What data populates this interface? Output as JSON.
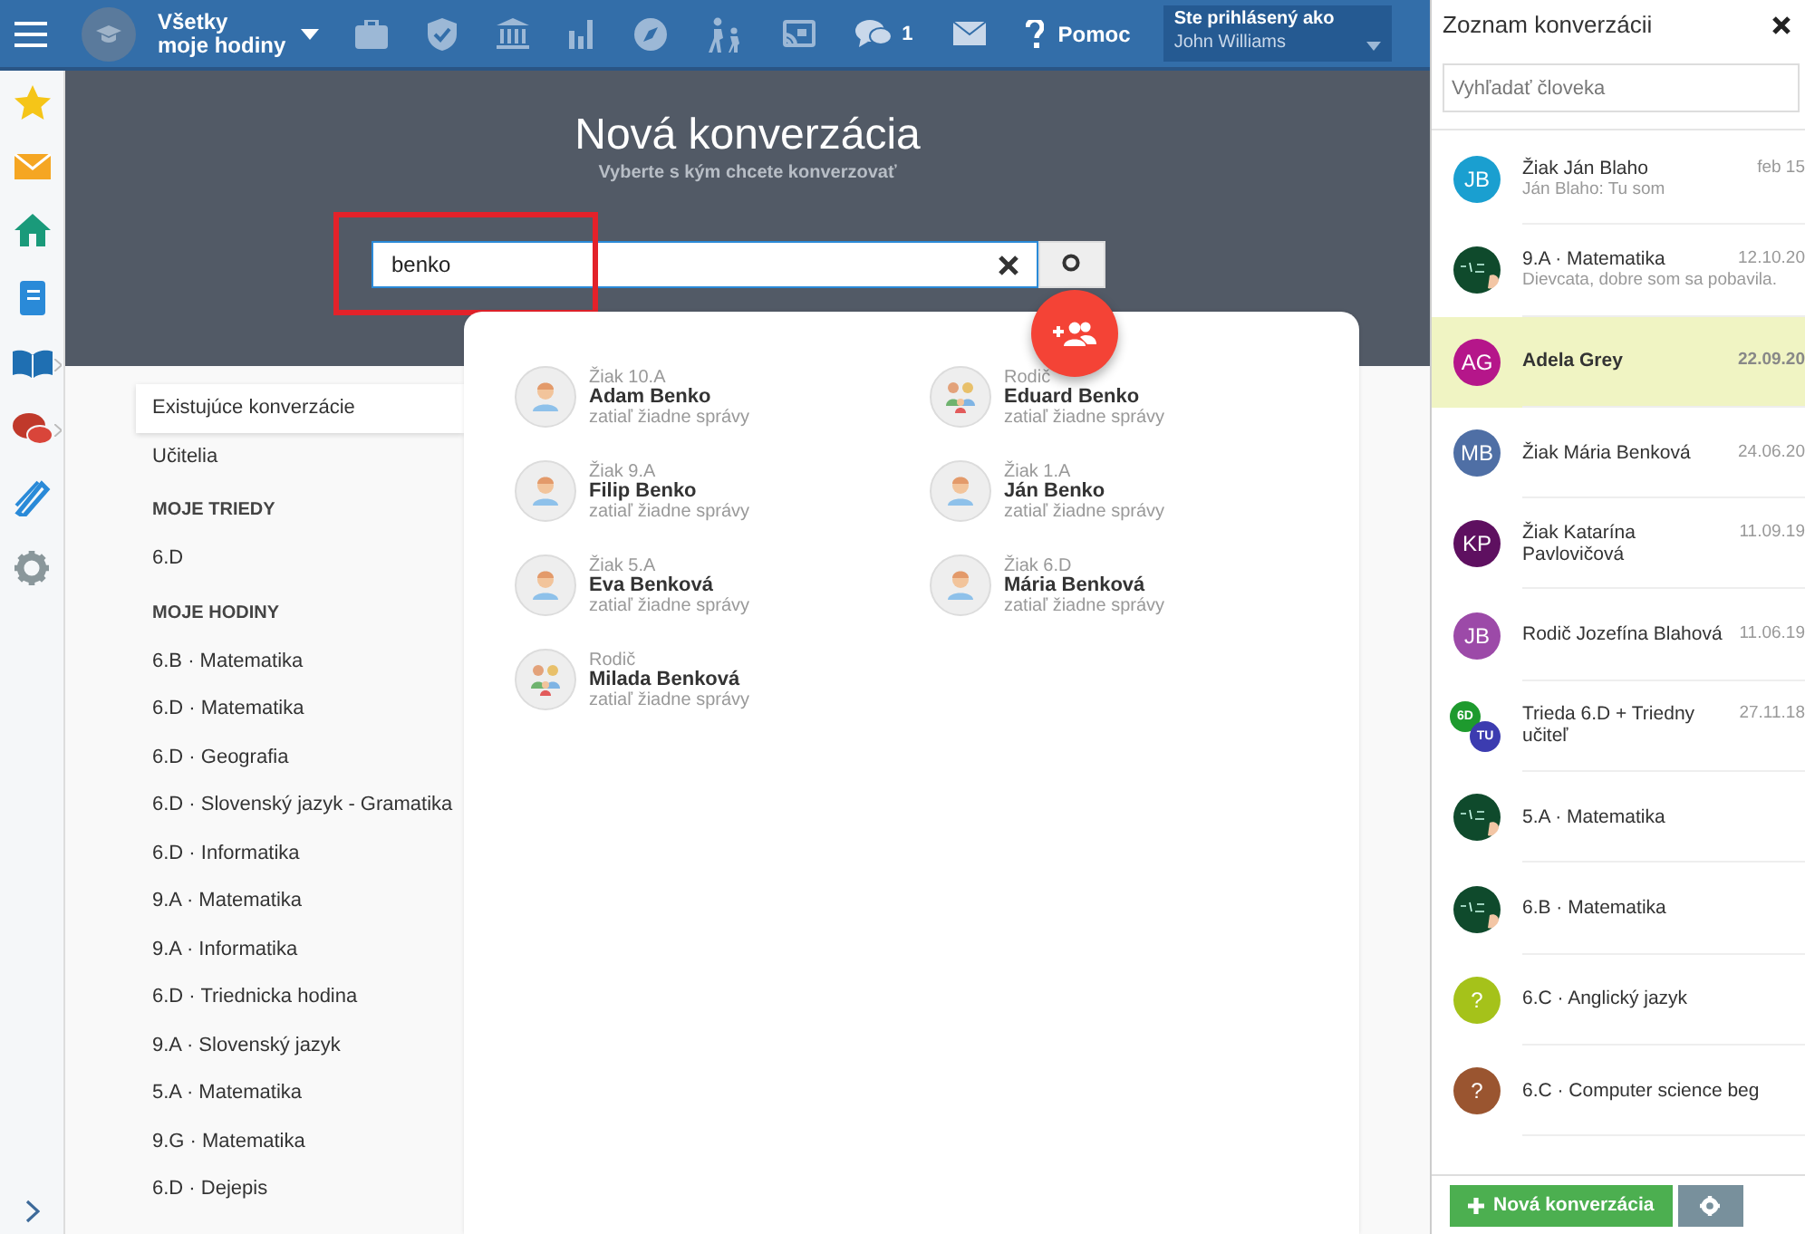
{
  "topbar": {
    "course_selector": [
      "Všetky",
      "moje hodiny"
    ],
    "chat_count": "1",
    "help": "Pomoc",
    "user": {
      "label": "Ste prihlásený ako",
      "name": "John Williams"
    }
  },
  "new_conversation": {
    "title": "Nová konverzácia",
    "subtitle": "Vyberte s kým chcete konverzovať",
    "search": {
      "value": "benko"
    },
    "results": [
      {
        "role": "Žiak 10.A",
        "name": "Adam Benko",
        "status": "zatiaľ žiadne správy",
        "kind": "student"
      },
      {
        "role": "Rodič",
        "name": "Eduard Benko",
        "status": "zatiaľ žiadne správy",
        "kind": "parent"
      },
      {
        "role": "Žiak 9.A",
        "name": "Filip Benko",
        "status": "zatiaľ žiadne správy",
        "kind": "student"
      },
      {
        "role": "Žiak 1.A",
        "name": "Ján Benko",
        "status": "zatiaľ žiadne správy",
        "kind": "student"
      },
      {
        "role": "Žiak 5.A",
        "name": "Eva Benková",
        "status": "zatiaľ žiadne správy",
        "kind": "student"
      },
      {
        "role": "Žiak 6.D",
        "name": "Mária Benková",
        "status": "zatiaľ žiadne správy",
        "kind": "student"
      },
      {
        "role": "Rodič",
        "name": "Milada Benková",
        "status": "zatiaľ žiadne správy",
        "kind": "parent"
      }
    ]
  },
  "nav": {
    "items": [
      {
        "label": "Existujúce konverzácie",
        "selected": true
      },
      {
        "label": "Učitelia",
        "selected": false
      }
    ],
    "sections": [
      {
        "heading": "MOJE TRIEDY",
        "items": [
          {
            "label": "6.D",
            "selected": false
          }
        ]
      },
      {
        "heading": "MOJE HODINY",
        "items": [
          {
            "label": "6.B · Matematika",
            "selected": false
          },
          {
            "label": "6.D · Matematika",
            "selected": false
          },
          {
            "label": "6.D · Geografia",
            "selected": false
          },
          {
            "label": "6.D · Slovenský jazyk - Gramatika",
            "selected": false
          },
          {
            "label": "6.D · Informatika",
            "selected": false
          },
          {
            "label": "9.A · Matematika",
            "selected": false
          },
          {
            "label": "9.A · Informatika",
            "selected": false
          },
          {
            "label": "6.D · Triednicka hodina",
            "selected": false
          },
          {
            "label": "9.A · Slovenský jazyk",
            "selected": false
          },
          {
            "label": "5.A · Matematika",
            "selected": false
          },
          {
            "label": "9.G · Matematika",
            "selected": false
          },
          {
            "label": "6.D · Dejepis",
            "selected": false
          }
        ]
      }
    ]
  },
  "conversation_list": {
    "title": "Zoznam konverzácii",
    "search": {
      "placeholder": "Vyhľadať človeka"
    },
    "items": [
      {
        "avatar": {
          "kind": "initials",
          "text": "JB",
          "color": "#1a9fd0"
        },
        "name": "Žiak Ján Blaho",
        "preview": "Ján Blaho: Tu som",
        "date": "feb 15",
        "selected": false
      },
      {
        "avatar": {
          "kind": "chalkboard"
        },
        "name": "9.A · Matematika",
        "preview": "Dievcata, dobre som sa pobavila.",
        "date": "12.10.20",
        "selected": false
      },
      {
        "avatar": {
          "kind": "initials",
          "text": "AG",
          "color": "#b5168a"
        },
        "name": "Adela Grey",
        "date": "22.09.20",
        "selected": true
      },
      {
        "avatar": {
          "kind": "initials",
          "text": "MB",
          "color": "#4f6fa5"
        },
        "name": "Žiak Mária Benková",
        "date": "24.06.20",
        "selected": false
      },
      {
        "avatar": {
          "kind": "initials",
          "text": "KP",
          "color": "#5e1060"
        },
        "name": "Žiak Katarína Pavlovičová",
        "date": "11.09.19",
        "selected": false
      },
      {
        "avatar": {
          "kind": "initials",
          "text": "JB",
          "color": "#9c4aa8"
        },
        "name": "Rodič Jozefína Blahová",
        "date": "11.06.19",
        "selected": false
      },
      {
        "avatar": {
          "kind": "pair",
          "parts": [
            {
              "text": "6D",
              "color": "#1e9a2e"
            },
            {
              "text": "TU",
              "color": "#3c3cb0"
            }
          ]
        },
        "name": "Trieda 6.D + Triedny učiteľ",
        "date": "27.11.18",
        "selected": false
      },
      {
        "avatar": {
          "kind": "chalkboard"
        },
        "name": "5.A · Matematika",
        "selected": false
      },
      {
        "avatar": {
          "kind": "chalkboard"
        },
        "name": "6.B · Matematika",
        "selected": false
      },
      {
        "avatar": {
          "kind": "initials",
          "text": "?",
          "color": "#a5c21a"
        },
        "name": "6.C · Anglický jazyk",
        "selected": false
      },
      {
        "avatar": {
          "kind": "initials",
          "text": "?",
          "color": "#9a5530"
        },
        "name": "6.C · Computer science beg",
        "selected": false
      }
    ],
    "new_button": "Nová konverzácia"
  }
}
